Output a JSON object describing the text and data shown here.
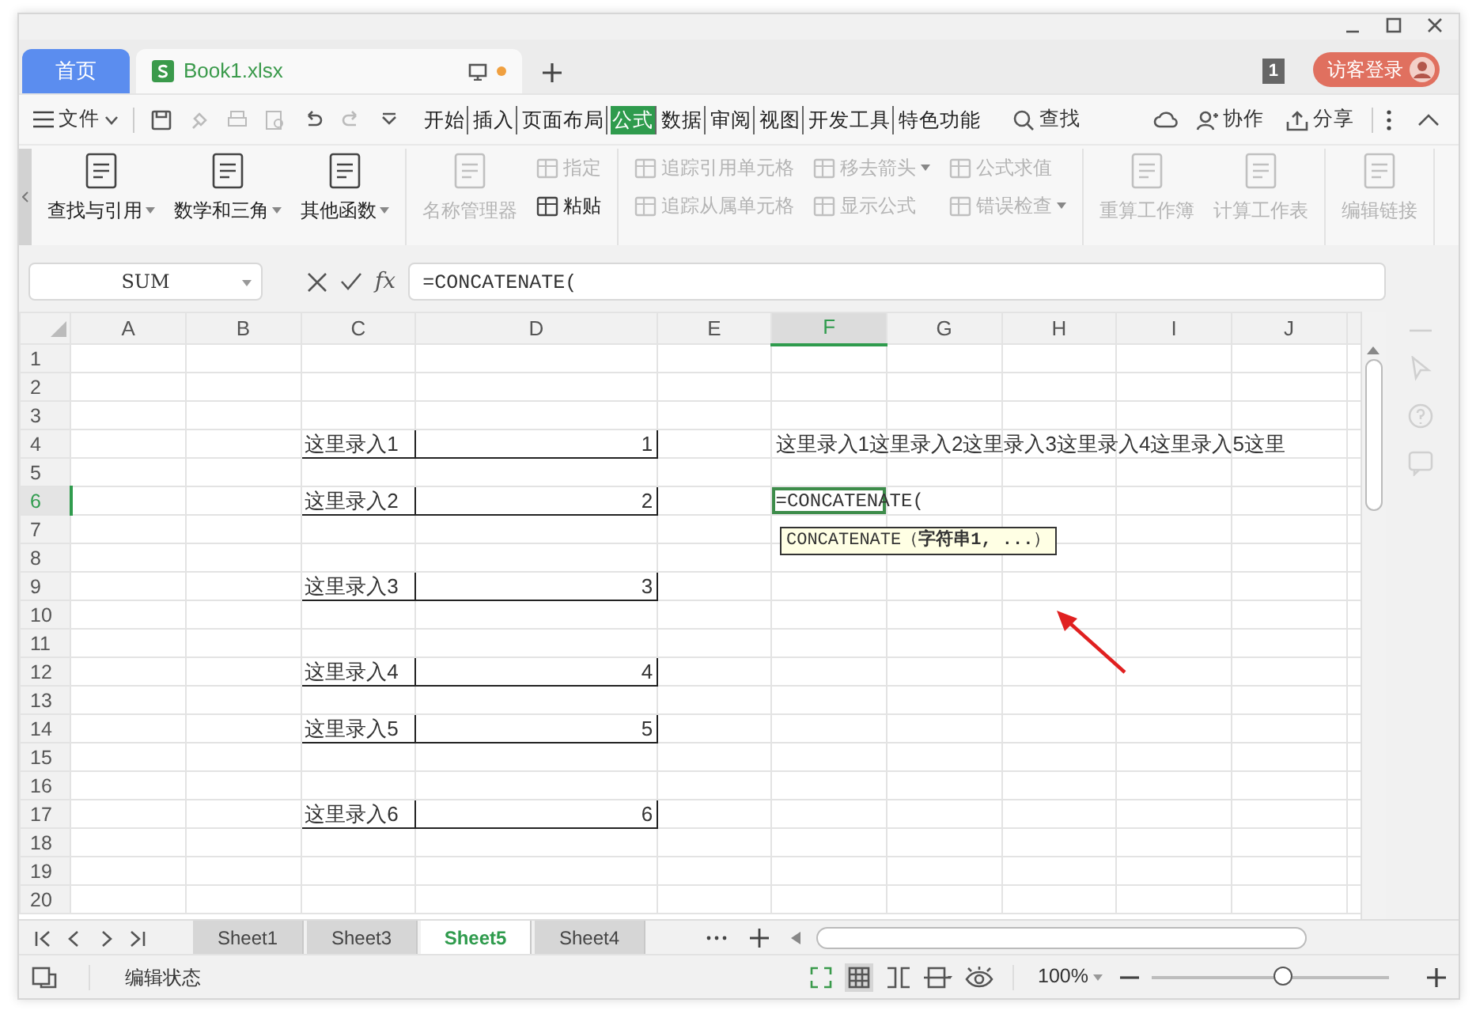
{
  "title_tabs": [
    {
      "label": "首页",
      "kind": "home",
      "selected": false
    },
    {
      "label": "Book1.xlsx",
      "kind": "file",
      "selected": true
    }
  ],
  "notification_count": "1",
  "login_button": "访客登录",
  "menu": {
    "file": "文件",
    "tabs": [
      {
        "label": "开始",
        "selected": false
      },
      {
        "label": "插入",
        "selected": false
      },
      {
        "label": "页面布局",
        "selected": false
      },
      {
        "label": "公式",
        "selected": true
      },
      {
        "label": "数据",
        "selected": false
      },
      {
        "label": "审阅",
        "selected": false
      },
      {
        "label": "视图",
        "selected": false
      },
      {
        "label": "开发工具",
        "selected": false
      },
      {
        "label": "特色功能",
        "selected": false
      }
    ],
    "search": "查找",
    "collaborate": "协作",
    "share": "分享"
  },
  "ribbon_groups": [
    [
      {
        "kind": "large",
        "label": "查找与引用",
        "menu": true,
        "disabled": false
      },
      {
        "kind": "large",
        "label": "数学和三角",
        "menu": true,
        "disabled": false
      },
      {
        "kind": "large",
        "label": "其他函数",
        "menu": true,
        "disabled": false
      }
    ],
    [
      {
        "kind": "large",
        "label": "名称管理器",
        "menu": false,
        "disabled": true
      },
      {
        "kind": "stack",
        "items": [
          {
            "label": "指定",
            "menu": false,
            "disabled": true
          },
          {
            "label": "粘贴",
            "menu": false,
            "disabled": false
          }
        ]
      }
    ],
    [
      {
        "kind": "stack",
        "items": [
          {
            "label": "追踪引用单元格",
            "menu": false,
            "disabled": true
          },
          {
            "label": "追踪从属单元格",
            "menu": false,
            "disabled": true
          }
        ]
      },
      {
        "kind": "stack",
        "items": [
          {
            "label": "移去箭头",
            "menu": true,
            "disabled": true
          },
          {
            "label": "显示公式",
            "menu": false,
            "disabled": true
          }
        ]
      },
      {
        "kind": "stack",
        "items": [
          {
            "label": "公式求值",
            "menu": false,
            "disabled": true
          },
          {
            "label": "错误检查",
            "menu": true,
            "disabled": true
          }
        ]
      }
    ],
    [
      {
        "kind": "large",
        "label": "重算工作簿",
        "menu": false,
        "disabled": true
      },
      {
        "kind": "large",
        "label": "计算工作表",
        "menu": false,
        "disabled": true
      }
    ],
    [
      {
        "kind": "large",
        "label": "编辑链接",
        "menu": false,
        "disabled": true
      }
    ]
  ],
  "formula_bar": {
    "name_box": "SUM",
    "fx": "fx",
    "value": "=CONCATENATE("
  },
  "sheet": {
    "columns": [
      {
        "label": "A",
        "selected": false
      },
      {
        "label": "B",
        "selected": false
      },
      {
        "label": "C",
        "selected": false
      },
      {
        "label": "D",
        "selected": false
      },
      {
        "label": "E",
        "selected": false
      },
      {
        "label": "F",
        "selected": true
      },
      {
        "label": "G",
        "selected": false
      },
      {
        "label": "H",
        "selected": false
      },
      {
        "label": "I",
        "selected": false
      },
      {
        "label": "J",
        "selected": false
      }
    ],
    "rows": [
      {
        "label": "1",
        "selected": false
      },
      {
        "label": "2",
        "selected": false
      },
      {
        "label": "3",
        "selected": false
      },
      {
        "label": "4",
        "selected": false,
        "cells": [
          null,
          null,
          {
            "text": "这里录入1",
            "kind": "text",
            "bordered": true
          },
          {
            "text": "1",
            "kind": "number",
            "bordered": true
          },
          null,
          {
            "text": "这里录入1这里录入2这里录入3这里录入4这里录入5这里",
            "kind": "text",
            "bordered": false
          }
        ]
      },
      {
        "label": "5",
        "selected": false
      },
      {
        "label": "6",
        "selected": true,
        "cells": [
          null,
          null,
          {
            "text": "这里录入2",
            "kind": "text",
            "bordered": true
          },
          {
            "text": "2",
            "kind": "number",
            "bordered": true
          },
          null,
          {
            "text": "=CONCATENATE(",
            "kind": "text",
            "bordered": false,
            "active": true
          }
        ]
      },
      {
        "label": "7",
        "selected": false
      },
      {
        "label": "8",
        "selected": false
      },
      {
        "label": "9",
        "selected": false,
        "cells": [
          null,
          null,
          {
            "text": "这里录入3",
            "kind": "text",
            "bordered": true
          },
          {
            "text": "3",
            "kind": "number",
            "bordered": true
          }
        ]
      },
      {
        "label": "10",
        "selected": false
      },
      {
        "label": "11",
        "selected": false
      },
      {
        "label": "12",
        "selected": false,
        "cells": [
          null,
          null,
          {
            "text": "这里录入4",
            "kind": "text",
            "bordered": true
          },
          {
            "text": "4",
            "kind": "number",
            "bordered": true
          }
        ]
      },
      {
        "label": "13",
        "selected": false
      },
      {
        "label": "14",
        "selected": false,
        "cells": [
          null,
          null,
          {
            "text": "这里录入5",
            "kind": "text",
            "bordered": true
          },
          {
            "text": "5",
            "kind": "number",
            "bordered": true
          }
        ]
      },
      {
        "label": "15",
        "selected": false
      },
      {
        "label": "16",
        "selected": false
      },
      {
        "label": "17",
        "selected": false,
        "cells": [
          null,
          null,
          {
            "text": "这里录入6",
            "kind": "text",
            "bordered": true
          },
          {
            "text": "6",
            "kind": "number",
            "bordered": true
          }
        ]
      },
      {
        "label": "18",
        "selected": false
      },
      {
        "label": "19",
        "selected": false
      },
      {
        "label": "20",
        "selected": false
      }
    ],
    "tooltip": "CONCATENATE（**字符串1, ...**）"
  },
  "sheet_tabs": [
    {
      "label": "Sheet1",
      "selected": false
    },
    {
      "label": "Sheet3",
      "selected": false
    },
    {
      "label": "Sheet5",
      "selected": true
    },
    {
      "label": "Sheet4",
      "selected": false
    }
  ],
  "status_bar": {
    "mode": "编辑状态",
    "zoom": "100%",
    "zoom_slider": {
      "level": 0.55
    }
  }
}
